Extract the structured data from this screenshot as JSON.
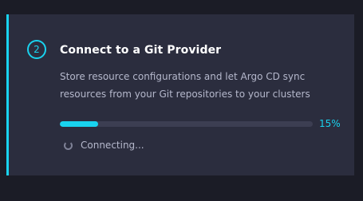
{
  "step": {
    "number": "2",
    "title": "Connect to a Git Provider",
    "description": "Store resource configurations and let Argo CD sync resources from your Git repositories to your clusters"
  },
  "progress": {
    "value": 0.15,
    "label": "15%"
  },
  "status": {
    "text": "Connecting...",
    "icon": "spinner-icon"
  },
  "colors": {
    "accent": "#19d3ef",
    "card_background": "#2b2d3e",
    "page_background": "#1b1c26",
    "track": "#3c3e52",
    "muted_text": "#b5b8cc"
  }
}
